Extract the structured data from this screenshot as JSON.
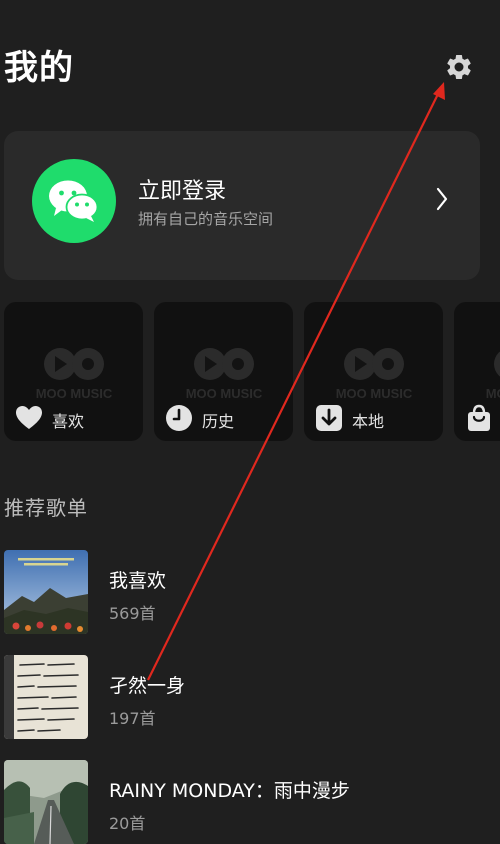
{
  "header": {
    "title": "我的",
    "settings_icon": "gear-icon"
  },
  "login": {
    "title": "立即登录",
    "subtitle": "拥有自己的音乐空间",
    "avatar_icon": "wechat-icon",
    "chevron": "〉",
    "accent": "#1fdc6c"
  },
  "quick_access": {
    "watermark": "MOO MUSIC",
    "items": [
      {
        "label": "喜欢",
        "icon": "heart-icon"
      },
      {
        "label": "历史",
        "icon": "clock-icon"
      },
      {
        "label": "本地",
        "icon": "download-icon"
      },
      {
        "label": "",
        "icon": "bag-icon"
      }
    ]
  },
  "recommend": {
    "title": "推荐歌单",
    "playlists": [
      {
        "name": "我喜欢",
        "count": "569首"
      },
      {
        "name": "孑然一身",
        "count": "197首"
      },
      {
        "name": "RAINY MONDAY：雨中漫步",
        "count": "20首"
      }
    ]
  },
  "colors": {
    "background": "#1f1f1f",
    "card": "#2a2a2a",
    "tile": "#111111",
    "annotation_arrow": "#e0281e"
  }
}
